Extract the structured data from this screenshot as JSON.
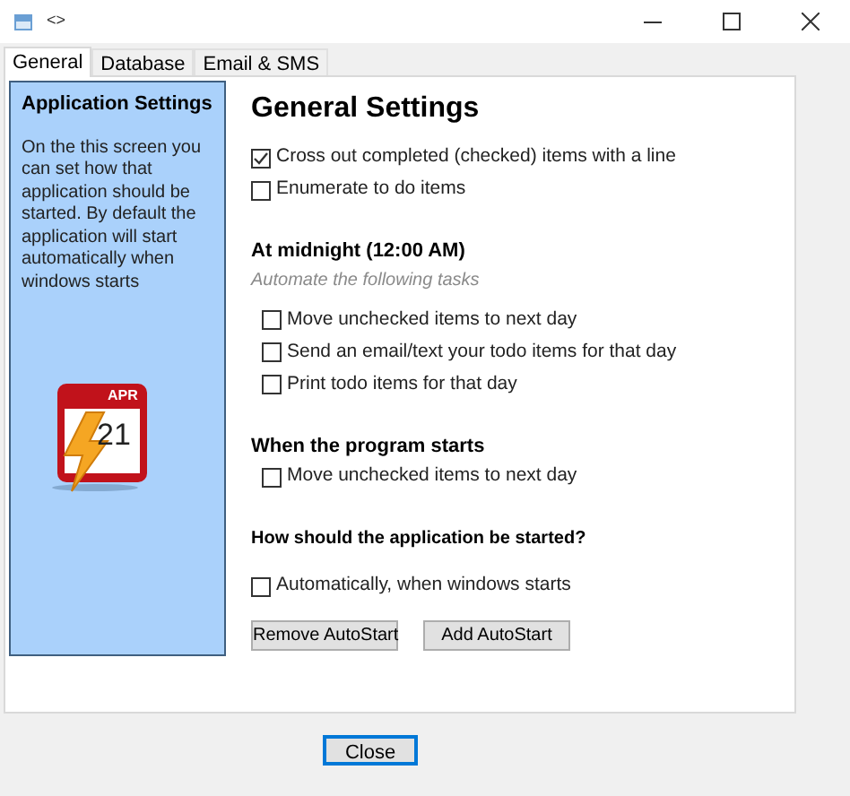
{
  "window": {
    "title": "<>"
  },
  "tabs": [
    {
      "label": "General",
      "selected": true
    },
    {
      "label": "Database",
      "selected": false
    },
    {
      "label": "Email & SMS",
      "selected": false
    }
  ],
  "sidebar": {
    "title": "Application Settings",
    "text": "On the this screen you can set how that application should be started. By default the application will start automatically when windows starts",
    "calendar_month": "APR",
    "calendar_day": "21"
  },
  "content": [
    {
      "kind": "title",
      "text": "General Settings"
    },
    {
      "kind": "checkbox",
      "label": "Cross out completed (checked) items with a line",
      "checked": true,
      "indented": false
    },
    {
      "kind": "checkbox",
      "label": "Enumerate to do items",
      "checked": false,
      "indented": false
    },
    {
      "kind": "heading",
      "text": "At midnight (12:00 AM)"
    },
    {
      "kind": "note",
      "text": "Automate the following tasks"
    },
    {
      "kind": "checkbox",
      "label": "Move unchecked items to next day",
      "checked": false,
      "indented": true
    },
    {
      "kind": "checkbox",
      "label": "Send an email/text your todo items for that day",
      "checked": false,
      "indented": true
    },
    {
      "kind": "checkbox",
      "label": "Print todo items for that day",
      "checked": false,
      "indented": true
    },
    {
      "kind": "heading",
      "text": "When the program starts"
    },
    {
      "kind": "checkbox",
      "label": "Move unchecked items to next day",
      "checked": false,
      "indented": true
    },
    {
      "kind": "question",
      "text": "How should the application be started?"
    },
    {
      "kind": "checkbox",
      "label": "Automatically, when windows starts",
      "checked": false,
      "indented": false
    },
    {
      "kind": "buttons",
      "labels": [
        "Remove AutoStart",
        "Add AutoStart"
      ]
    }
  ],
  "close_button": "Close"
}
